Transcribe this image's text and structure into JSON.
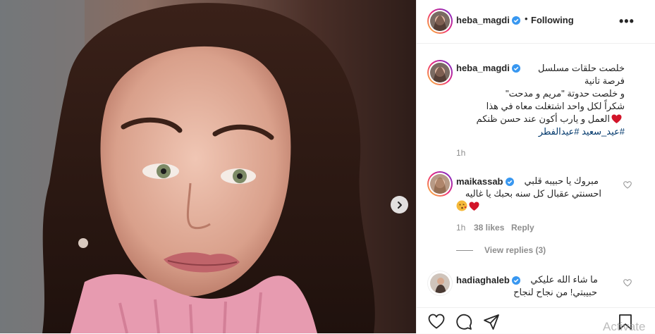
{
  "post": {
    "author": "heba_magdi",
    "following_label": "Following",
    "separator": "•",
    "more_label": "•••",
    "caption_user": "heba_magdi",
    "caption_lines": [
      "خلصت حلقات مسلسل",
      "فرصة تانية",
      "و خلصت حدوتة \"مريم و مدحت\"",
      "شكراً لكل واحد اشتغلت معاه في هذا",
      "العمل و يارب أكون عند حسن ظنكم",
      "#عيد_سعيد #عيدالفطر"
    ],
    "caption_time": "1h"
  },
  "comments": [
    {
      "user": "maikassab",
      "lines": [
        "مبروك يا حبيبه قلبي",
        "احسنتي عقبال كل سنه بحبك يا غاليه"
      ],
      "time": "1h",
      "likes": "38 likes",
      "reply_label": "Reply",
      "view_replies": "View replies (3)"
    },
    {
      "user": "hadiaghaleb",
      "lines": [
        "ما شاء الله عليكي",
        "حبيبتي! من نجاح لنجاح"
      ]
    }
  ],
  "watermark": "Activate",
  "colors": {
    "heart": "#e0245e",
    "verified": "#3897f0",
    "link": "#00376b",
    "muted": "#8e8e8e"
  },
  "icons": [
    "heart-icon",
    "comment-icon",
    "share-icon",
    "bookmark-icon",
    "chevron-right-icon",
    "verified-icon"
  ]
}
